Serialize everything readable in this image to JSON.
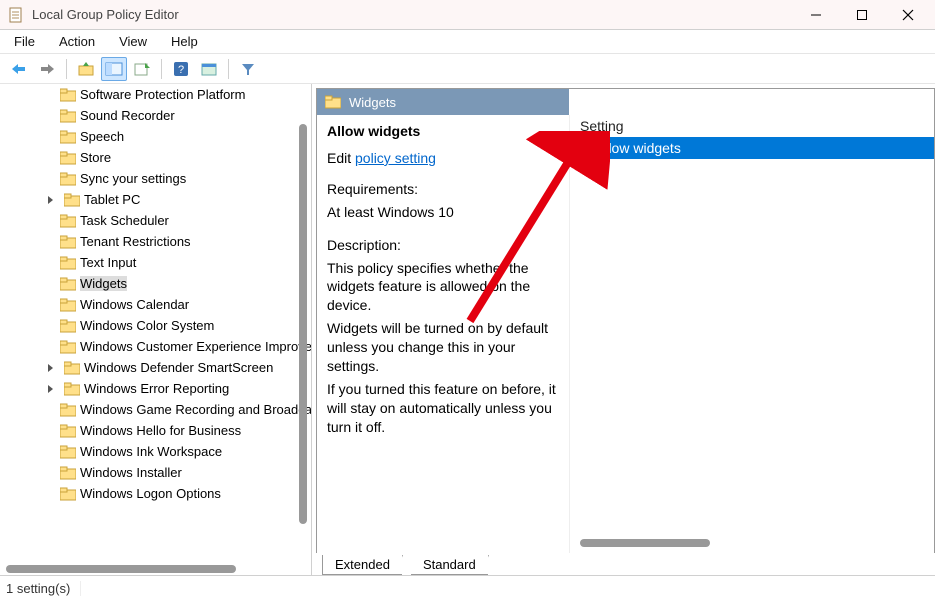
{
  "window": {
    "title": "Local Group Policy Editor"
  },
  "menu": {
    "file": "File",
    "action": "Action",
    "view": "View",
    "help": "Help"
  },
  "tree": {
    "items": [
      {
        "label": "Software Protection Platform",
        "chevron": false
      },
      {
        "label": "Sound Recorder",
        "chevron": false
      },
      {
        "label": "Speech",
        "chevron": false
      },
      {
        "label": "Store",
        "chevron": false
      },
      {
        "label": "Sync your settings",
        "chevron": false
      },
      {
        "label": "Tablet PC",
        "chevron": true
      },
      {
        "label": "Task Scheduler",
        "chevron": false
      },
      {
        "label": "Tenant Restrictions",
        "chevron": false
      },
      {
        "label": "Text Input",
        "chevron": false
      },
      {
        "label": "Widgets",
        "chevron": false,
        "selected": true
      },
      {
        "label": "Windows Calendar",
        "chevron": false
      },
      {
        "label": "Windows Color System",
        "chevron": false
      },
      {
        "label": "Windows Customer Experience Improvement Program",
        "chevron": false
      },
      {
        "label": "Windows Defender SmartScreen",
        "chevron": true
      },
      {
        "label": "Windows Error Reporting",
        "chevron": true
      },
      {
        "label": "Windows Game Recording and Broadcasting",
        "chevron": false
      },
      {
        "label": "Windows Hello for Business",
        "chevron": false
      },
      {
        "label": "Windows Ink Workspace",
        "chevron": false
      },
      {
        "label": "Windows Installer",
        "chevron": false
      },
      {
        "label": "Windows Logon Options",
        "chevron": false
      }
    ]
  },
  "category": {
    "name": "Widgets"
  },
  "detail": {
    "title": "Allow widgets",
    "editPrefix": "Edit ",
    "editLink": "policy setting ",
    "reqLabel": "Requirements:",
    "reqValue": "At least Windows 10",
    "descLabel": "Description:",
    "descBody1": "This policy specifies whether the widgets feature is allowed on the device.",
    "descBody2": "Widgets will be turned on by default unless you change this in your settings.",
    "descBody3": "If you turned this feature on before, it will stay on automatically unless you turn it off."
  },
  "settingCol": {
    "header": "Setting",
    "rows": [
      {
        "label": "Allow widgets",
        "selected": true
      }
    ]
  },
  "tabs": {
    "extended": "Extended",
    "standard": "Standard"
  },
  "status": {
    "text": "1 setting(s)"
  }
}
